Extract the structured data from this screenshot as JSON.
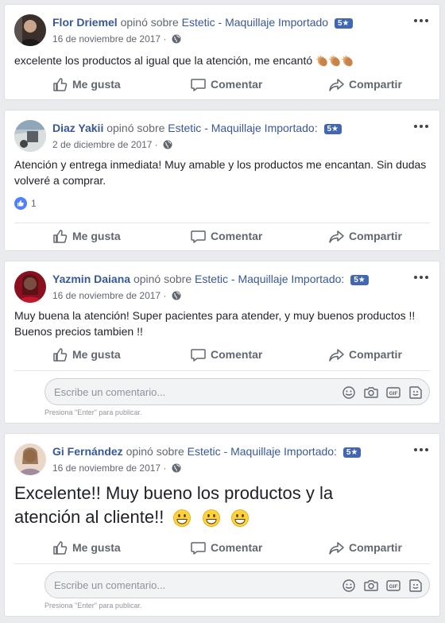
{
  "reviews": [
    {
      "author": "Flor Driemel",
      "verb": "opinó sobre",
      "page": "Estetic - Maquillaje Importado",
      "rating": "5★",
      "date": "16 de noviembre de 2017",
      "sep": "·",
      "text": "excelente los productos al igual que la atención, me encantó",
      "emoji": "clapping-hands x3"
    },
    {
      "author": "Diaz Yakii",
      "verb": "opinó sobre",
      "page": "Estetic - Maquillaje Importado:",
      "rating": "5★",
      "date": "2 de diciembre de 2017",
      "sep": "·",
      "text": "Atención y entrega inmediata! Muy amable y los productos me encantan. Sin dudas volveré a comprar.",
      "likes": "1"
    },
    {
      "author": "Yazmin Daiana",
      "verb": "opinó sobre",
      "page": "Estetic - Maquillaje Importado:",
      "rating": "5★",
      "date": "16 de noviembre de 2017",
      "sep": "·",
      "text_line1": "Muy buena la atención! Super pacientes para atender, y muy buenos productos !!",
      "text_line2": "Buenos precios tambien !!"
    },
    {
      "author": "Gi Fernández",
      "verb": "opinó sobre",
      "page": "Estetic - Maquillaje Importado:",
      "rating": "5★",
      "date": "16 de noviembre de 2017",
      "sep": "·",
      "text_line1": "Excelente!! Muy bueno los productos y la",
      "text_line2": "atención al cliente!!",
      "emoji": "grinning-face x3"
    }
  ],
  "actions": {
    "like": "Me gusta",
    "comment": "Comentar",
    "share": "Compartir"
  },
  "comment_box": {
    "placeholder": "Escribe un comentario...",
    "hint": "Presiona \"Enter\" para publicar."
  },
  "colors": {
    "link": "#385898",
    "badge": "#4267b2",
    "background": "#e9ebee"
  }
}
